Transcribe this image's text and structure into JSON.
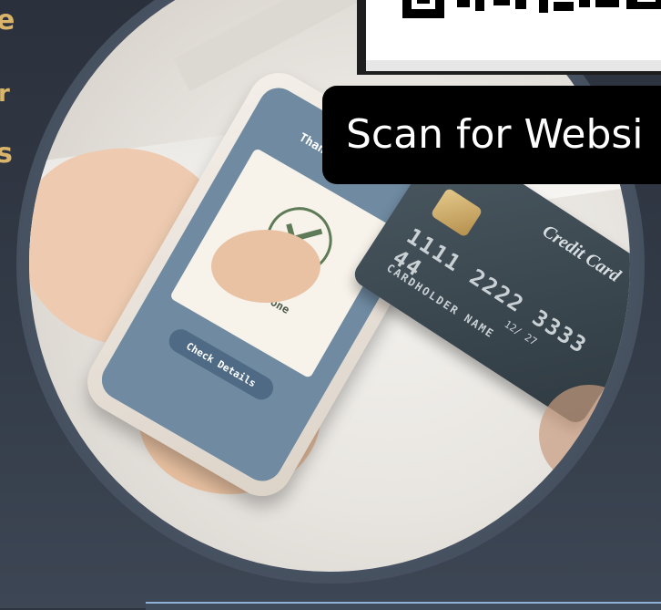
{
  "phone_screen": {
    "thank_you": "Thank You",
    "status": "Payment Done",
    "button": "Check Details"
  },
  "credit_card": {
    "title": "Credit Card",
    "number": "1111 2222 3333 44",
    "expiry": "12/ 27",
    "holder": "CARDHOLDER NAME"
  },
  "banner": {
    "text": "Scan for Websi"
  },
  "left_panel": {
    "line1": "e",
    "line2": "r",
    "line3": "s"
  }
}
